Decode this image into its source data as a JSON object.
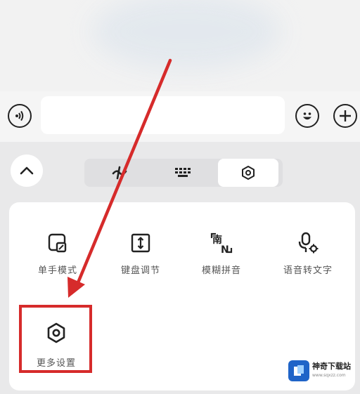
{
  "keyboard_toolbar": {
    "tabs": [
      "handwriting",
      "keyboard",
      "settings"
    ],
    "active_tab": "settings"
  },
  "settings_panel": {
    "items": [
      {
        "label": "单手模式",
        "icon": "one-hand-mode-icon"
      },
      {
        "label": "键盘调节",
        "icon": "keyboard-height-icon"
      },
      {
        "label": "模糊拼音",
        "icon": "fuzzy-pinyin-icon"
      },
      {
        "label": "语音转文字",
        "icon": "voice-to-text-icon"
      },
      {
        "label": "更多设置",
        "icon": "more-settings-icon"
      }
    ]
  },
  "icons": {
    "fuzzy_top": "南",
    "fuzzy_bottom": "N"
  },
  "watermark": {
    "title": "神奇下载站",
    "subtitle": "www.sqxzz.com"
  },
  "colors": {
    "annotation_red": "#d62b2b",
    "brand_blue": "#1f64c8"
  }
}
